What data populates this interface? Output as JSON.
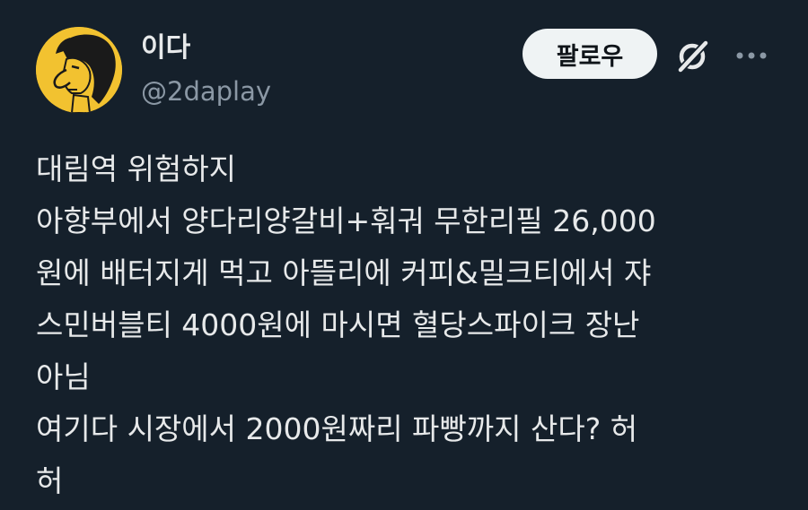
{
  "author": {
    "display_name": "이다",
    "handle": "@2daplay",
    "avatar_icon": "cartoon-profile-avatar",
    "avatar_color": "#f2c230"
  },
  "actions": {
    "follow_label": "팔로우",
    "grok_icon": "grok-icon",
    "more_icon": "more-icon"
  },
  "tweet": {
    "lines": [
      "대림역 위험하지",
      "아향부에서 양다리양갈비+훠궈 무한리필 26,000",
      "원에 배터지게 먹고 아뜰리에 커피&밀크티에서 쟈",
      "스민버블티 4000원에 마시면 혈당스파이크 장난",
      "아님",
      "여기다 시장에서 2000원짜리 파빵까지 산다? 허",
      "허"
    ]
  },
  "colors": {
    "background": "#15202b",
    "text": "#e7e9ea",
    "secondary_text": "#8b98a5",
    "button_bg": "#eff3f4"
  }
}
